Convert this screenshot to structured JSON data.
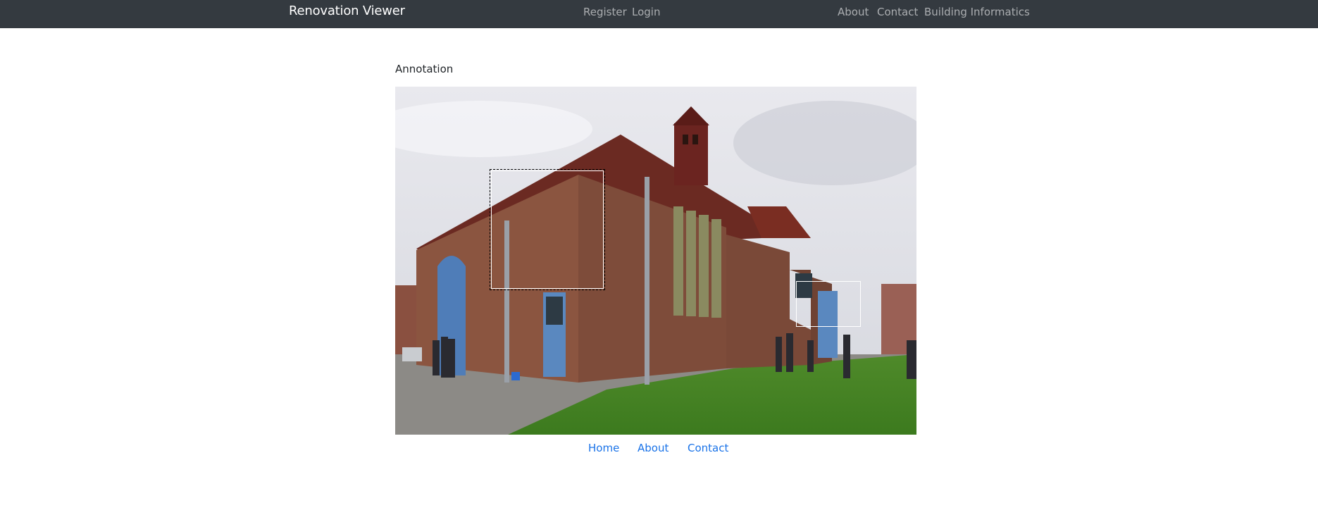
{
  "navbar": {
    "brand": "Renovation Viewer",
    "auth_links": [
      "Register",
      "Login"
    ],
    "right_links": [
      "About",
      "Contact",
      "Building Informatics"
    ]
  },
  "main": {
    "heading": "Annotation",
    "image": {
      "subject": "brick church exterior with people on lawn",
      "annotations": [
        {
          "style": "dashed"
        },
        {
          "style": "solid"
        }
      ]
    }
  },
  "footer": {
    "links": [
      "Home",
      "About",
      "Contact"
    ]
  },
  "colors": {
    "navbar_bg": "#343a40",
    "link_blue": "#1a73e8"
  }
}
